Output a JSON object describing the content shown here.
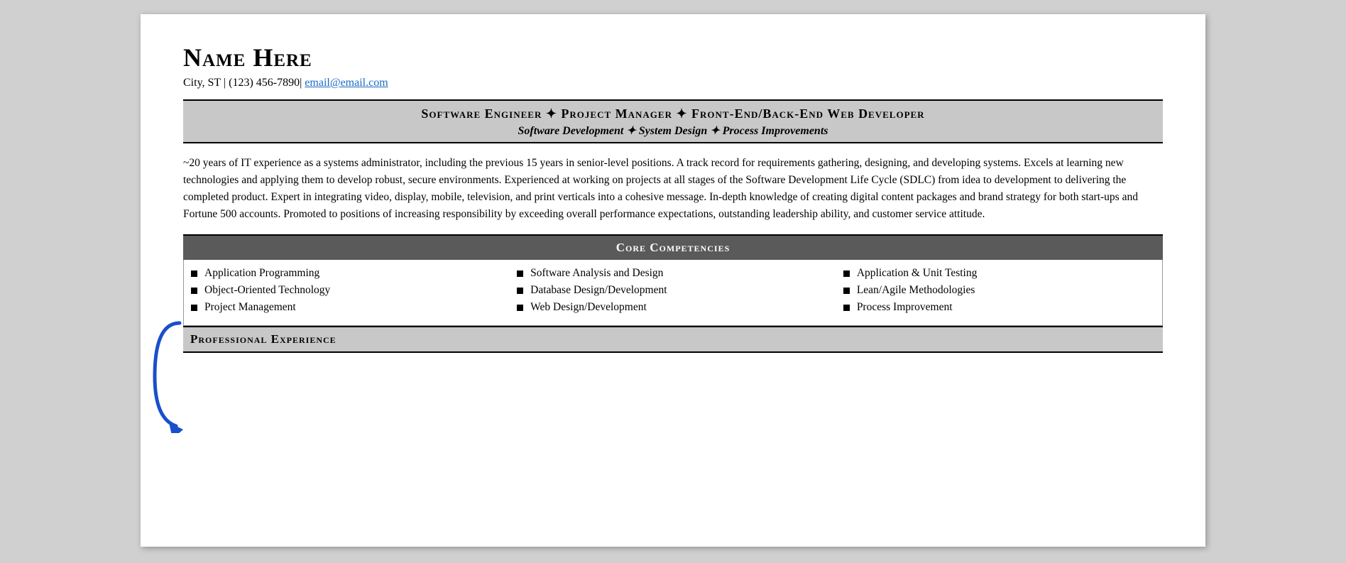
{
  "header": {
    "name": "Name Here",
    "contact": "City, ST | (123) 456-7890|",
    "email_text": "email@email.com",
    "email_href": "mailto:email@email.com"
  },
  "title_banner": {
    "main": "Software Engineer ✦ Project Manager ✦ Front-End/Back-End Web Developer",
    "sub": "Software Development ✦ System Design ✦ Process Improvements"
  },
  "summary": {
    "text": "~20 years of IT experience as a systems administrator, including the previous 15 years in senior-level positions. A track record for requirements gathering, designing, and developing systems. Excels at learning new technologies and applying them to develop robust, secure environments. Experienced at working on projects at all stages of the Software Development Life Cycle (SDLC) from idea to development to delivering the completed product. Expert in integrating video, display, mobile, television, and print verticals into a cohesive message. In-depth knowledge of creating digital content packages and brand strategy for both start-ups and Fortune 500 accounts. Promoted to positions of increasing responsibility by exceeding overall performance expectations, outstanding leadership ability, and customer service attitude."
  },
  "core_competencies": {
    "section_title": "Core Competencies",
    "columns": [
      {
        "items": [
          "Application Programming",
          "Object-Oriented Technology",
          "Project Management"
        ]
      },
      {
        "items": [
          "Software Analysis and Design",
          "Database Design/Development",
          "Web Design/Development"
        ]
      },
      {
        "items": [
          "Application & Unit Testing",
          "Lean/Agile Methodologies",
          "Process Improvement"
        ]
      }
    ]
  },
  "professional_experience": {
    "section_title": "Professional Experience"
  }
}
